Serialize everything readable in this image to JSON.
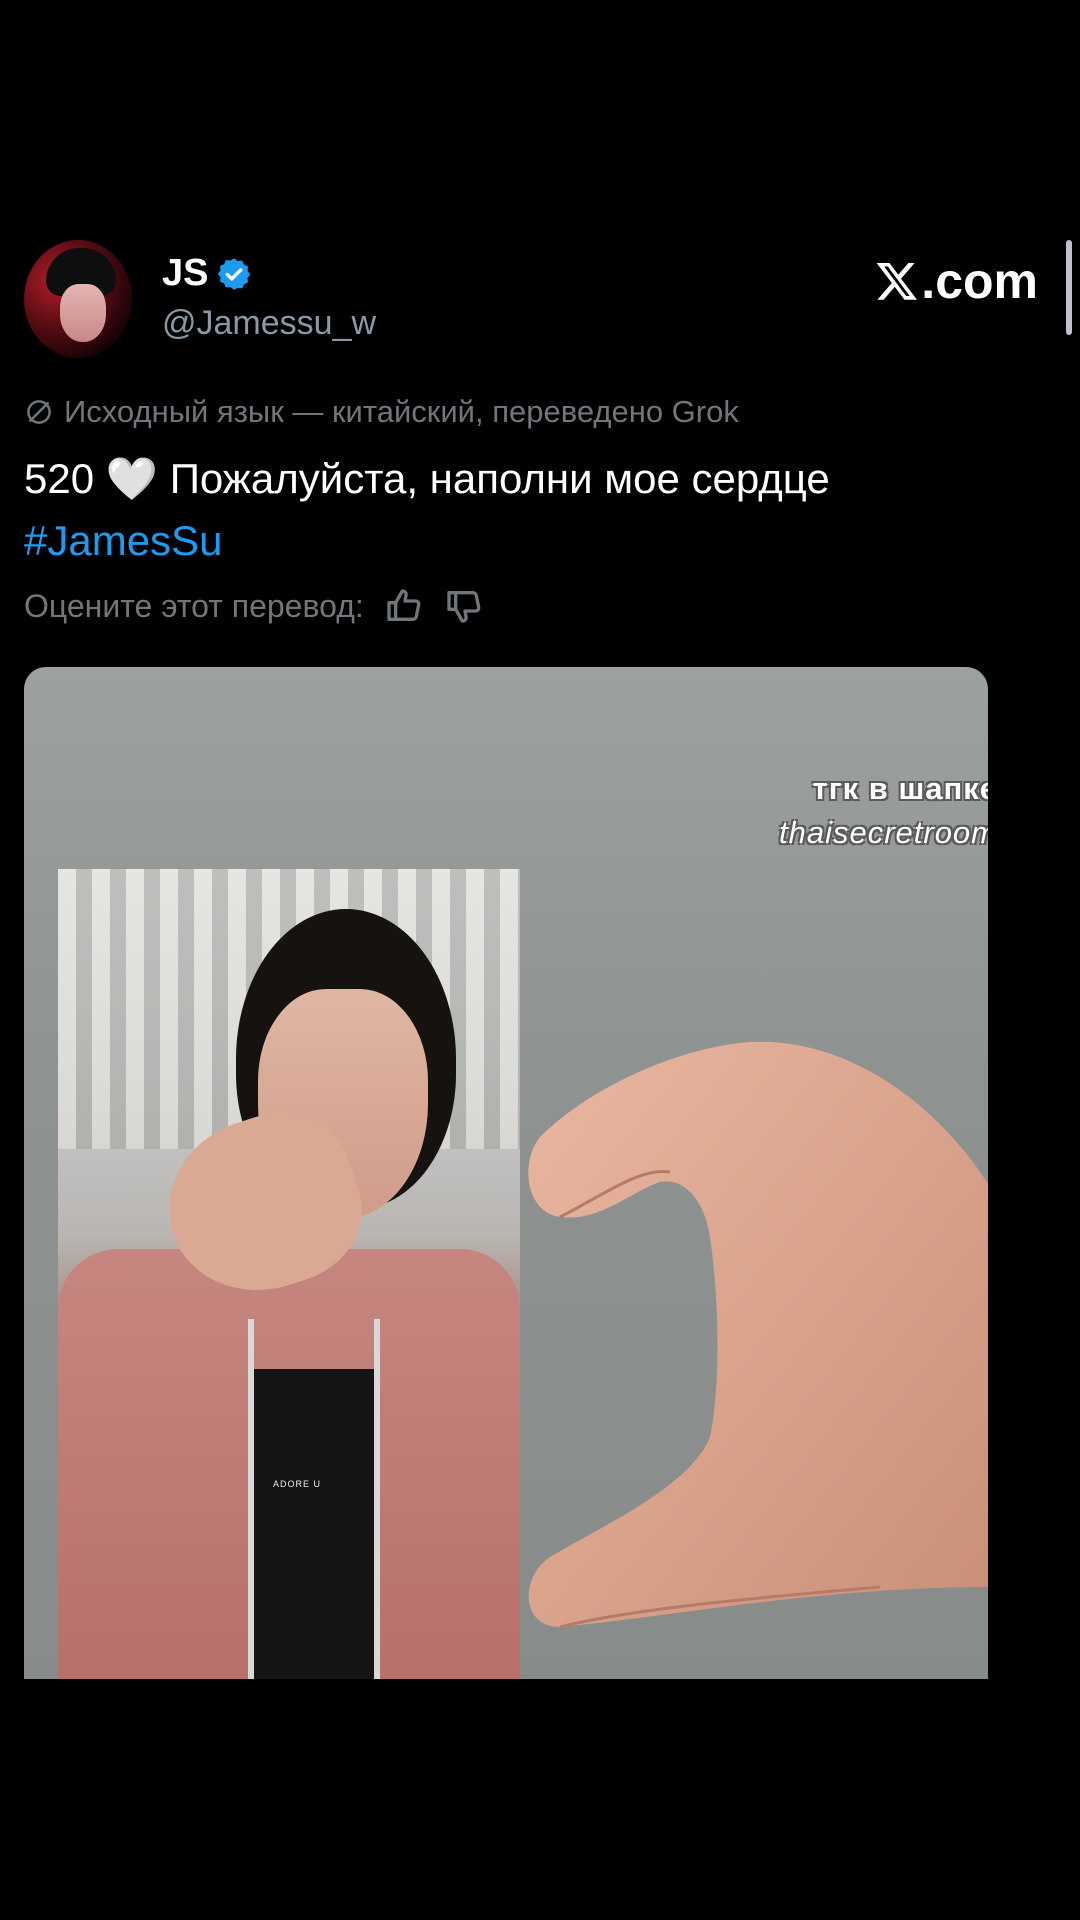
{
  "tweet": {
    "display_name": "JS",
    "handle": "@Jamessu_w",
    "brand": ".com",
    "translation_note": "Исходный язык — китайский, переведено Grok",
    "text": "520 🤍 Пожалуйста, наполни мое сердце",
    "hashtag": "#JamesSu",
    "rate_label": "Оцените этот перевод:"
  },
  "media": {
    "watermark_line1": "тгк в шапке",
    "watermark_line2": "thaisecretroom",
    "photo_label": "ADORE U"
  },
  "colors": {
    "background": "#000000",
    "text_primary": "#ffffff",
    "text_secondary": "#71767b",
    "hashtag": "#1d9bf0",
    "verified": "#1d9bf0"
  },
  "icons": {
    "verified": "verified-badge-icon",
    "brand": "x-logo-icon",
    "translate": "globe-translate-icon",
    "like": "thumbs-up-icon",
    "dislike": "thumbs-down-icon"
  }
}
